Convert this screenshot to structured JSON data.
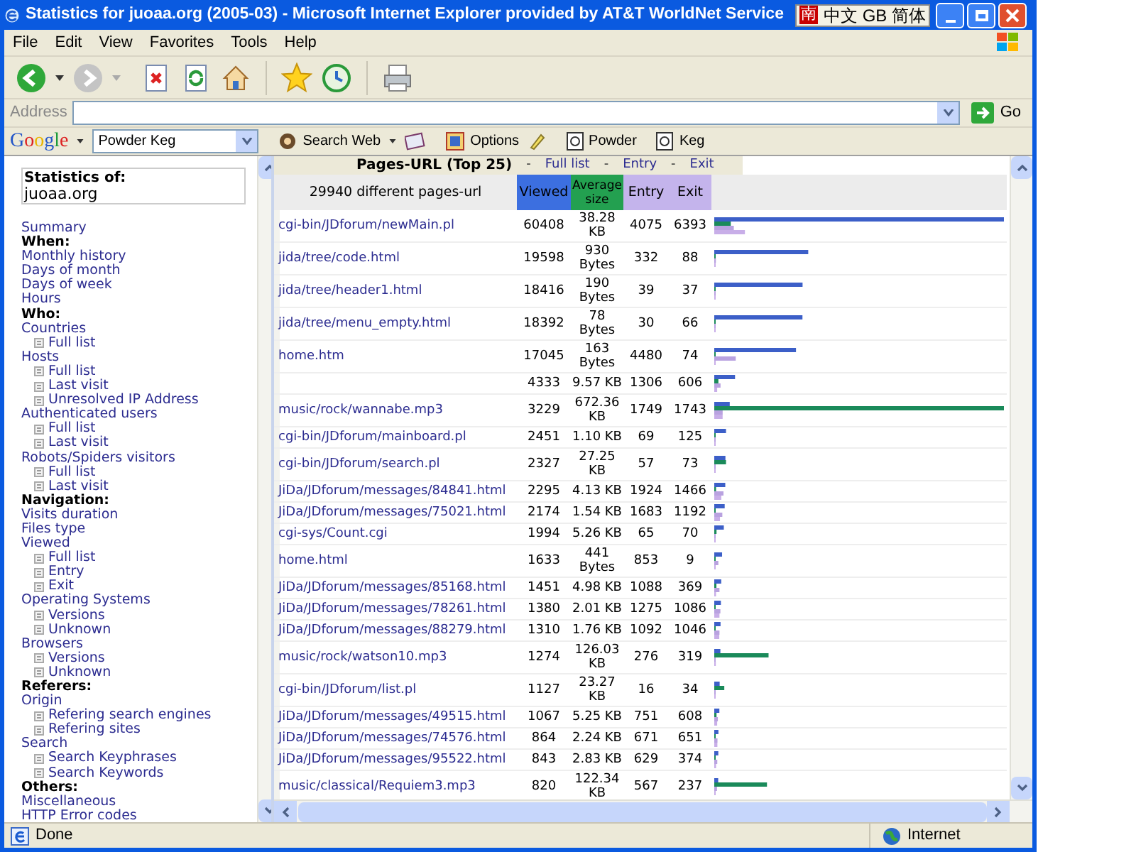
{
  "window": {
    "title": "Statistics for juoaa.org (2005-03) - Microsoft Internet Explorer provided by AT&T WorldNet Service",
    "ime_badge": {
      "mark": "南",
      "label": "中文 GB 简体"
    }
  },
  "menu_bar": [
    "File",
    "Edit",
    "View",
    "Favorites",
    "Tools",
    "Help"
  ],
  "address_bar": {
    "label": "Address",
    "go": "Go"
  },
  "google_bar": {
    "logo": "Google",
    "search_value": "Powder Keg",
    "search_web": "Search Web",
    "options": "Options",
    "highlights": [
      "Powder",
      "Keg"
    ]
  },
  "sidebar": {
    "title": "Statistics of:",
    "site": "juoaa.org",
    "items": [
      {
        "kind": "link",
        "label": "Summary"
      },
      {
        "kind": "heading",
        "label": "When:"
      },
      {
        "kind": "link",
        "label": "Monthly history"
      },
      {
        "kind": "link",
        "label": "Days of month"
      },
      {
        "kind": "link",
        "label": "Days of week"
      },
      {
        "kind": "link",
        "label": "Hours"
      },
      {
        "kind": "heading",
        "label": "Who:"
      },
      {
        "kind": "link",
        "label": "Countries",
        "children": [
          {
            "label": "Full list"
          }
        ]
      },
      {
        "kind": "link",
        "label": "Hosts",
        "children": [
          {
            "label": "Full list"
          },
          {
            "label": "Last visit"
          },
          {
            "label": "Unresolved IP Address"
          }
        ]
      },
      {
        "kind": "link",
        "label": "Authenticated users",
        "children": [
          {
            "label": "Full list"
          },
          {
            "label": "Last visit"
          }
        ]
      },
      {
        "kind": "link",
        "label": "Robots/Spiders visitors",
        "children": [
          {
            "label": "Full list"
          },
          {
            "label": "Last visit"
          }
        ]
      },
      {
        "kind": "heading",
        "label": "Navigation:"
      },
      {
        "kind": "link",
        "label": "Visits duration"
      },
      {
        "kind": "link",
        "label": "Files type"
      },
      {
        "kind": "link",
        "label": "Viewed",
        "children": [
          {
            "label": "Full list"
          },
          {
            "label": "Entry"
          },
          {
            "label": "Exit"
          }
        ]
      },
      {
        "kind": "link",
        "label": "Operating Systems",
        "children": [
          {
            "label": "Versions"
          },
          {
            "label": "Unknown"
          }
        ]
      },
      {
        "kind": "link",
        "label": "Browsers",
        "children": [
          {
            "label": "Versions"
          },
          {
            "label": "Unknown"
          }
        ]
      },
      {
        "kind": "heading",
        "label": "Referers:"
      },
      {
        "kind": "link",
        "label": "Origin",
        "children": [
          {
            "label": "Refering search engines"
          },
          {
            "label": "Refering sites"
          }
        ]
      },
      {
        "kind": "link",
        "label": "Search",
        "children": [
          {
            "label": "Search Keyphrases"
          },
          {
            "label": "Search Keywords"
          }
        ]
      },
      {
        "kind": "heading",
        "label": "Others:"
      },
      {
        "kind": "link",
        "label": "Miscellaneous"
      },
      {
        "kind": "link",
        "label": "HTTP Error codes"
      }
    ]
  },
  "report": {
    "title": "Pages-URL (Top 25)",
    "separator": "-",
    "links": [
      "Full list",
      "Entry",
      "Exit"
    ],
    "columns": [
      "29940 different pages-url",
      "Viewed",
      "Average size",
      "Entry",
      "Exit"
    ],
    "rows": [
      {
        "url": "cgi-bin/JDforum/newMain.pl",
        "viewed": "60408",
        "size": "38.28 KB",
        "entry": "4075",
        "exit": "6393"
      },
      {
        "url": "jida/tree/code.html",
        "viewed": "19598",
        "size": "930 Bytes",
        "entry": "332",
        "exit": "88"
      },
      {
        "url": "jida/tree/header1.html",
        "viewed": "18416",
        "size": "190 Bytes",
        "entry": "39",
        "exit": "37"
      },
      {
        "url": "jida/tree/menu_empty.html",
        "viewed": "18392",
        "size": "78 Bytes",
        "entry": "30",
        "exit": "66"
      },
      {
        "url": "home.htm",
        "viewed": "17045",
        "size": "163 Bytes",
        "entry": "4480",
        "exit": "74"
      },
      {
        "viewed": "4333",
        "size": "9.57 KB",
        "entry": "1306",
        "exit": "606"
      },
      {
        "url": "music/rock/wannabe.mp3",
        "viewed": "3229",
        "size": "672.36 KB",
        "entry": "1749",
        "exit": "1743"
      },
      {
        "url": "cgi-bin/JDforum/mainboard.pl",
        "viewed": "2451",
        "size": "1.10 KB",
        "entry": "69",
        "exit": "125"
      },
      {
        "url": "cgi-bin/JDforum/search.pl",
        "viewed": "2327",
        "size": "27.25 KB",
        "entry": "57",
        "exit": "73"
      },
      {
        "url": "JiDa/JDforum/messages/84841.html",
        "viewed": "2295",
        "size": "4.13 KB",
        "entry": "1924",
        "exit": "1466"
      },
      {
        "url": "JiDa/JDforum/messages/75021.html",
        "viewed": "2174",
        "size": "1.54 KB",
        "entry": "1683",
        "exit": "1192"
      },
      {
        "url": "cgi-sys/Count.cgi",
        "viewed": "1994",
        "size": "5.26 KB",
        "entry": "65",
        "exit": "70"
      },
      {
        "url": "home.html",
        "viewed": "1633",
        "size": "441 Bytes",
        "entry": "853",
        "exit": "9"
      },
      {
        "url": "JiDa/JDforum/messages/85168.html",
        "viewed": "1451",
        "size": "4.98 KB",
        "entry": "1088",
        "exit": "369"
      },
      {
        "url": "JiDa/JDforum/messages/78261.html",
        "viewed": "1380",
        "size": "2.01 KB",
        "entry": "1275",
        "exit": "1086"
      },
      {
        "url": "JiDa/JDforum/messages/88279.html",
        "viewed": "1310",
        "size": "1.76 KB",
        "entry": "1092",
        "exit": "1046"
      },
      {
        "url": "music/rock/watson10.mp3",
        "viewed": "1274",
        "size": "126.03 KB",
        "entry": "276",
        "exit": "319"
      },
      {
        "url": "cgi-bin/JDforum/list.pl",
        "viewed": "1127",
        "size": "23.27 KB",
        "entry": "16",
        "exit": "34"
      },
      {
        "url": "JiDa/JDforum/messages/49515.html",
        "viewed": "1067",
        "size": "5.25 KB",
        "entry": "751",
        "exit": "608"
      },
      {
        "url": "JiDa/JDforum/messages/74576.html",
        "viewed": "864",
        "size": "2.24 KB",
        "entry": "671",
        "exit": "651"
      },
      {
        "url": "JiDa/JDforum/messages/95522.html",
        "viewed": "843",
        "size": "2.83 KB",
        "entry": "629",
        "exit": "374"
      },
      {
        "url": "music/classical/Requiem3.mp3",
        "viewed": "820",
        "size": "122.34 KB",
        "entry": "567",
        "exit": "237"
      }
    ]
  },
  "status_bar": {
    "text": "Done",
    "zone": "Internet"
  }
}
